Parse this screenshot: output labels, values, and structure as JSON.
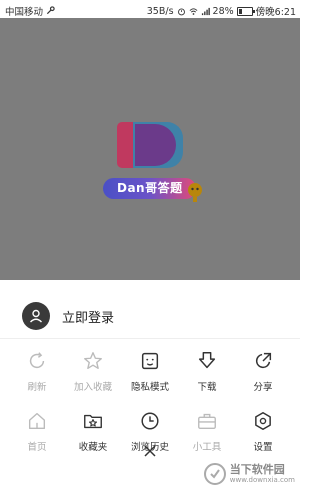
{
  "status_bar": {
    "carrier": "中国移动",
    "speed": "35B/s",
    "battery": "28%",
    "time": "傍晚6:21",
    "battery_level": 0.28
  },
  "app": {
    "badge_text": "Dan哥答题"
  },
  "menu": {
    "login_label": "立即登录",
    "rows": [
      [
        {
          "label": "刷新",
          "icon": "refresh-icon",
          "enabled": false
        },
        {
          "label": "加入收藏",
          "icon": "star-icon",
          "enabled": false
        },
        {
          "label": "隐私模式",
          "icon": "incognito-face-icon",
          "enabled": true
        },
        {
          "label": "下载",
          "icon": "download-arrow-icon",
          "enabled": true
        },
        {
          "label": "分享",
          "icon": "share-icon",
          "enabled": true
        }
      ],
      [
        {
          "label": "首页",
          "icon": "home-icon",
          "enabled": false
        },
        {
          "label": "收藏夹",
          "icon": "bookmark-folder-icon",
          "enabled": true
        },
        {
          "label": "浏览历史",
          "icon": "clock-icon",
          "enabled": true
        },
        {
          "label": "小工具",
          "icon": "toolbox-icon",
          "enabled": false
        },
        {
          "label": "设置",
          "icon": "settings-hexagon-icon",
          "enabled": true
        }
      ]
    ]
  },
  "watermark": {
    "title": "当下软件园",
    "url": "www.downxia.com"
  },
  "colors": {
    "overlay": "#7d7d7d",
    "icon_active": "#333333",
    "icon_inactive": "#bbbbbb"
  }
}
